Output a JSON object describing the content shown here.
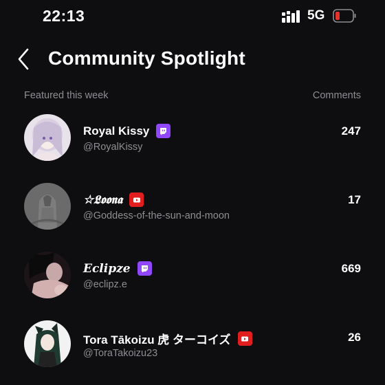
{
  "status_bar": {
    "time": "22:13",
    "network": "5G"
  },
  "header": {
    "title": "Community Spotlight"
  },
  "columns": {
    "left": "Featured this week",
    "right": "Comments"
  },
  "entries": [
    {
      "name": "Royal Kissy",
      "handle": "@RoyalKissy",
      "comments": "247",
      "platform": "twitch-icon"
    },
    {
      "name": "☆𝕷𝖔𝖔𝖓𝖆",
      "handle": "@Goddess-of-the-sun-and-moon",
      "comments": "17",
      "platform": "youtube-icon"
    },
    {
      "name": "𝑬𝒄𝒍𝒊𝒑𝒛𝒆",
      "handle": "@eclipz.e",
      "comments": "669",
      "platform": "twitch-icon"
    },
    {
      "name": "Tora Tākoizu 虎 ターコイズ",
      "handle": "@ToraTakoizu23",
      "comments": "26",
      "platform": "youtube-icon"
    }
  ],
  "colors": {
    "background": "#0e0e10",
    "secondary_text": "#8e8e93",
    "twitch": "#9146ff",
    "youtube": "#e01e1e",
    "battery_low": "#e5322d"
  }
}
